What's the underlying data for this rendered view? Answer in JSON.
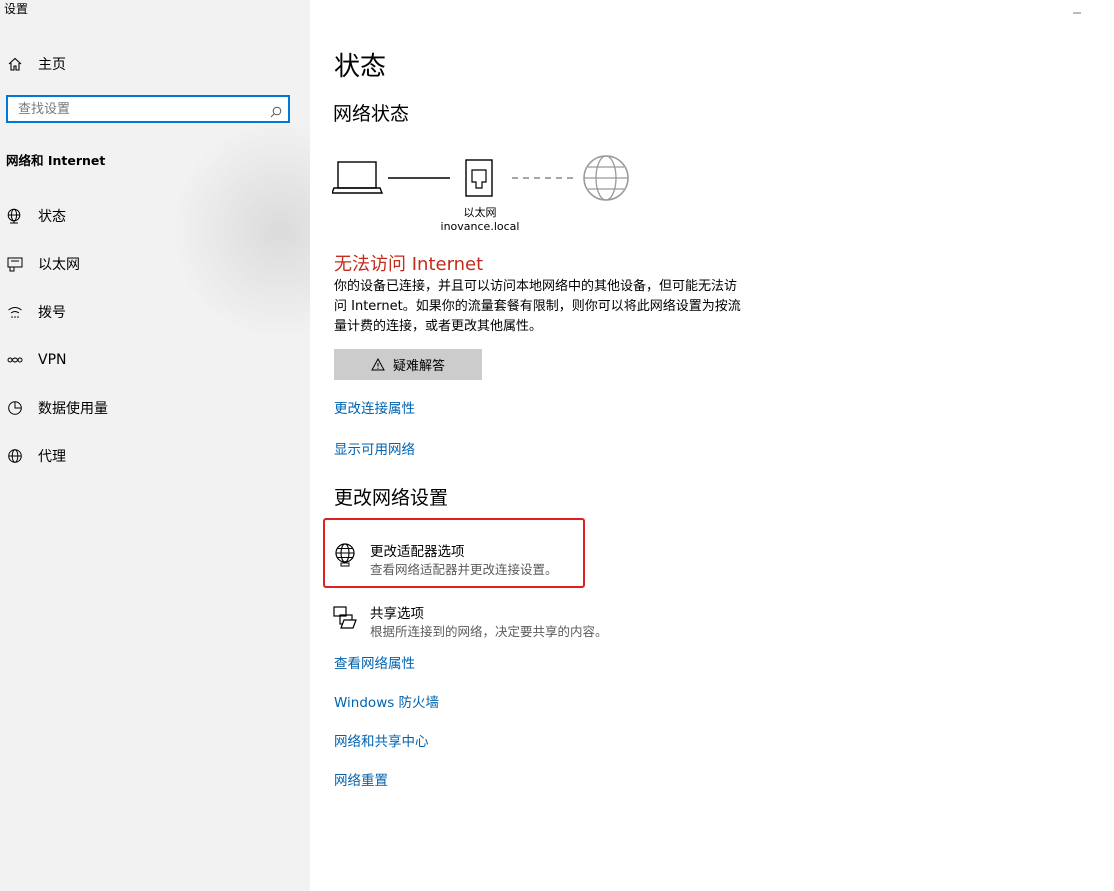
{
  "window": {
    "title": "设置"
  },
  "sidebar": {
    "home_label": "主页",
    "search_placeholder": "查找设置",
    "section_label": "网络和 Internet",
    "items": [
      {
        "label": "状态",
        "icon": "globe-status-icon"
      },
      {
        "label": "以太网",
        "icon": "ethernet-icon"
      },
      {
        "label": "拨号",
        "icon": "dialup-icon"
      },
      {
        "label": "VPN",
        "icon": "vpn-icon"
      },
      {
        "label": "数据使用量",
        "icon": "data-usage-icon"
      },
      {
        "label": "代理",
        "icon": "proxy-globe-icon"
      }
    ]
  },
  "main": {
    "page_title": "状态",
    "network_status_heading": "网络状态",
    "diagram": {
      "adapter_name": "以太网",
      "domain": "inovance.local"
    },
    "error_title": "无法访问 Internet",
    "error_description": "你的设备已连接，并且可以访问本地网络中的其他设备，但可能无法访问 Internet。如果你的流量套餐有限制，则你可以将此网络设置为按流量计费的连接，或者更改其他属性。",
    "troubleshoot_label": "疑难解答",
    "links_top": [
      "更改连接属性",
      "显示可用网络"
    ],
    "change_settings_heading": "更改网络设置",
    "options": [
      {
        "title": "更改适配器选项",
        "desc": "查看网络适配器并更改连接设置。",
        "icon": "adapter-globe-icon"
      },
      {
        "title": "共享选项",
        "desc": "根据所连接到的网络，决定要共享的内容。",
        "icon": "sharing-icon"
      }
    ],
    "links_bottom": [
      "查看网络属性",
      "Windows 防火墙",
      "网络和共享中心",
      "网络重置"
    ]
  },
  "colors": {
    "accent": "#0078d7",
    "link": "#0063b1",
    "error": "#c42b1c",
    "highlight": "#e02020"
  }
}
